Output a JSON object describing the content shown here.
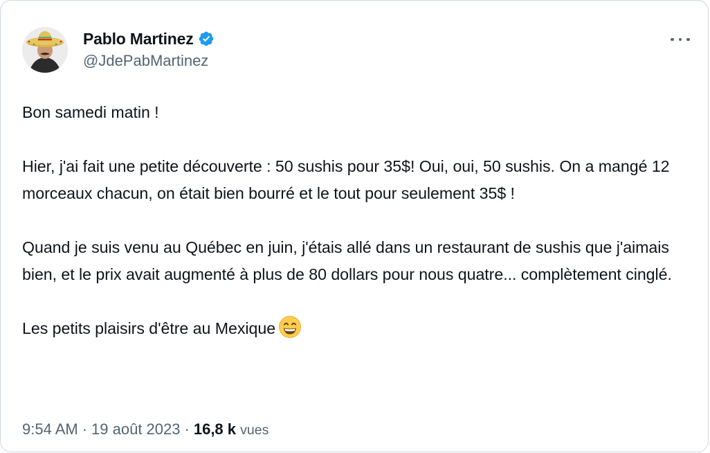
{
  "author": {
    "display_name": "Pablo Martinez",
    "handle": "@JdePabMartinez",
    "verified": true
  },
  "tweet": {
    "paragraphs": [
      "Bon samedi matin !",
      "Hier, j'ai fait une petite découverte : 50 sushis pour 35$! Oui, oui, 50 sushis. On a mangé 12 morceaux chacun, on était bien bourré et le tout pour seulement 35$ !",
      "Quand je suis venu au Québec en juin, j'étais allé dans un restaurant de sushis que j'aimais bien, et le prix avait augmenté à plus de 80 dollars pour nous quatre... complètement cinglé.",
      "Les petits plaisirs d'être au Mexique"
    ],
    "emoji": "grinning-face-with-smiling-eyes-icon"
  },
  "meta": {
    "time": "9:54 AM",
    "separator": "·",
    "date": "19 août 2023",
    "views_count": "16,8 k",
    "views_label": "vues"
  },
  "icons": {
    "more": "more-horizontal-icon",
    "verified": "verified-badge-icon"
  },
  "colors": {
    "verified_blue": "#1d9bf0",
    "secondary_text": "#536471",
    "primary_text": "#0f1419",
    "border": "#cfd9de"
  }
}
